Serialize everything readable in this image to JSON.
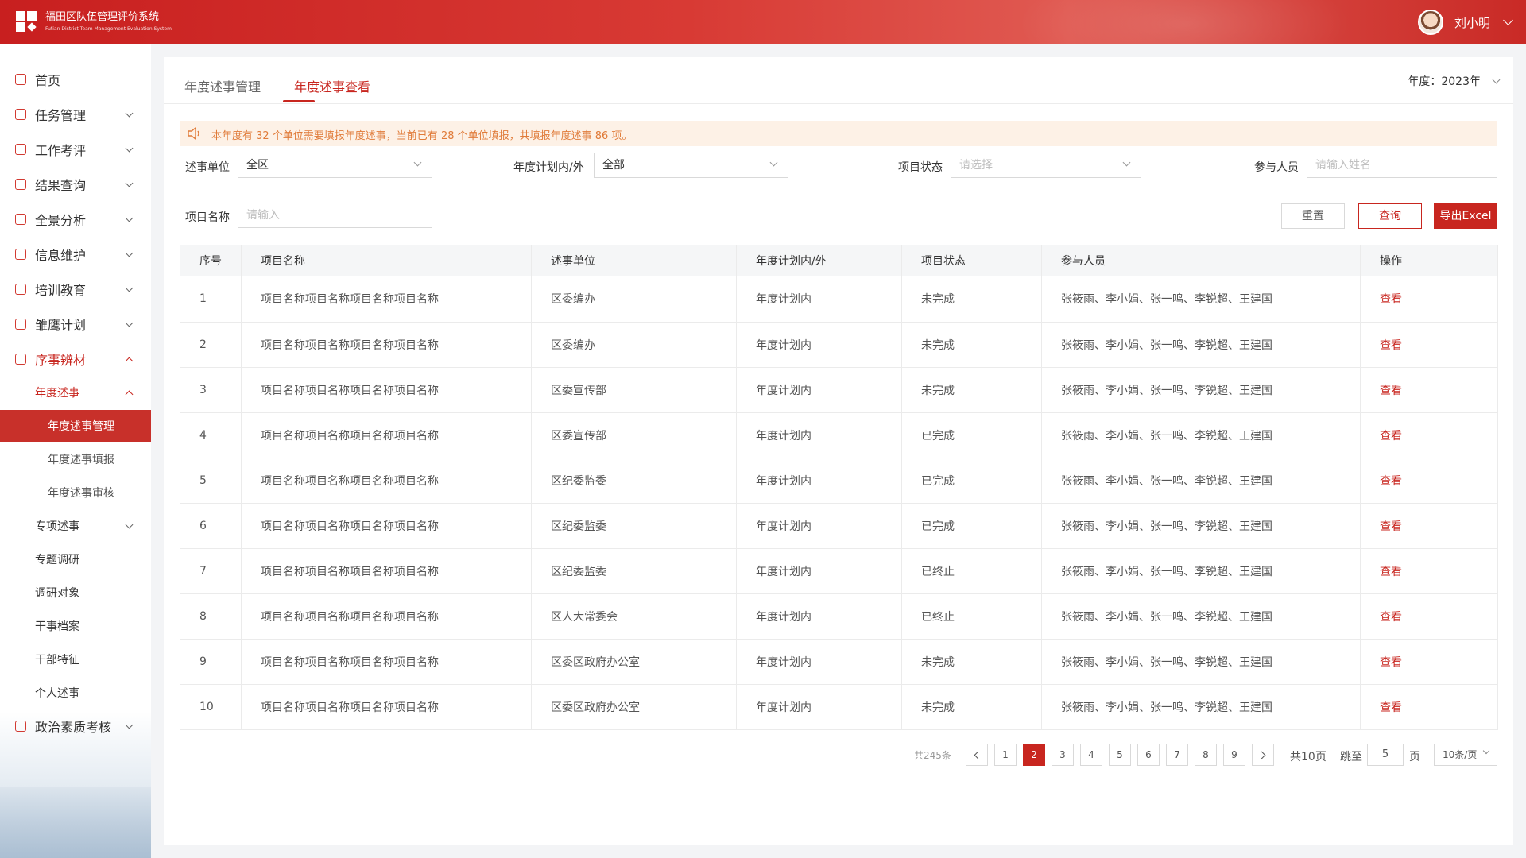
{
  "header": {
    "title": "福田区队伍管理评价系统",
    "subtitle": "Futian District Team Management Evaluation System",
    "user_name": "刘小明"
  },
  "sidebar": {
    "items": [
      {
        "label": "首页"
      },
      {
        "label": "任务管理"
      },
      {
        "label": "工作考评"
      },
      {
        "label": "结果查询"
      },
      {
        "label": "全景分析"
      },
      {
        "label": "信息维护"
      },
      {
        "label": "培训教育"
      },
      {
        "label": "雏鹰计划"
      },
      {
        "label": "序事辨材"
      }
    ],
    "sub": {
      "annual": "年度述事",
      "leaves": [
        "年度述事管理",
        "年度述事填报",
        "年度述事审核"
      ],
      "special": "专项述事",
      "research": "专题调研",
      "targets": "调研对象",
      "archive": "干事档案",
      "features": "干部特征",
      "personal": "个人述事"
    },
    "last": "政治素质考核"
  },
  "tabs": [
    "年度述事管理",
    "年度述事查看"
  ],
  "year_select": "年度：2023年",
  "notice": "本年度有 32 个单位需要填报年度述事，当前已有 28 个单位填报，共填报年度述事 86 项。",
  "filters": {
    "unit_label": "述事单位",
    "unit_value": "全区",
    "plan_label": "年度计划内/外",
    "plan_value": "全部",
    "status_label": "项目状态",
    "status_placeholder": "请选择",
    "people_label": "参与人员",
    "people_placeholder": "请输入姓名",
    "name_label": "项目名称",
    "name_placeholder": "请输入"
  },
  "buttons": {
    "reset": "重置",
    "query": "查询",
    "export": "导出Excel"
  },
  "table": {
    "columns": [
      "序号",
      "项目名称",
      "述事单位",
      "年度计划内/外",
      "项目状态",
      "参与人员",
      "操作"
    ],
    "rows": [
      [
        "1",
        "项目名称项目名称项目名称项目名称",
        "区委编办",
        "年度计划内",
        "未完成",
        "张筱雨、李小娟、张一鸣、李锐超、王建国",
        "查看"
      ],
      [
        "2",
        "项目名称项目名称项目名称项目名称",
        "区委编办",
        "年度计划内",
        "未完成",
        "张筱雨、李小娟、张一鸣、李锐超、王建国",
        "查看"
      ],
      [
        "3",
        "项目名称项目名称项目名称项目名称",
        "区委宣传部",
        "年度计划内",
        "未完成",
        "张筱雨、李小娟、张一鸣、李锐超、王建国",
        "查看"
      ],
      [
        "4",
        "项目名称项目名称项目名称项目名称",
        "区委宣传部",
        "年度计划内",
        "已完成",
        "张筱雨、李小娟、张一鸣、李锐超、王建国",
        "查看"
      ],
      [
        "5",
        "项目名称项目名称项目名称项目名称",
        "区纪委监委",
        "年度计划内",
        "已完成",
        "张筱雨、李小娟、张一鸣、李锐超、王建国",
        "查看"
      ],
      [
        "6",
        "项目名称项目名称项目名称项目名称",
        "区纪委监委",
        "年度计划内",
        "已完成",
        "张筱雨、李小娟、张一鸣、李锐超、王建国",
        "查看"
      ],
      [
        "7",
        "项目名称项目名称项目名称项目名称",
        "区纪委监委",
        "年度计划内",
        "已终止",
        "张筱雨、李小娟、张一鸣、李锐超、王建国",
        "查看"
      ],
      [
        "8",
        "项目名称项目名称项目名称项目名称",
        "区人大常委会",
        "年度计划内",
        "已终止",
        "张筱雨、李小娟、张一鸣、李锐超、王建国",
        "查看"
      ],
      [
        "9",
        "项目名称项目名称项目名称项目名称",
        "区委区政府办公室",
        "年度计划内",
        "未完成",
        "张筱雨、李小娟、张一鸣、李锐超、王建国",
        "查看"
      ],
      [
        "10",
        "项目名称项目名称项目名称项目名称",
        "区委区政府办公室",
        "年度计划内",
        "未完成",
        "张筱雨、李小娟、张一鸣、李锐超、王建国",
        "查看"
      ]
    ]
  },
  "pagination": {
    "total": "共245条",
    "pages": [
      "1",
      "2",
      "3",
      "4",
      "5",
      "6",
      "7",
      "8",
      "9"
    ],
    "current": "2",
    "page_count": "共10页",
    "jump_label": "跳至",
    "jump_value": "5",
    "page_unit": "页",
    "page_size": "10条/页"
  },
  "colors": {
    "accent": "#c8261f",
    "notice_text": "#e07b39",
    "notice_bg": "#fdf1e6"
  }
}
